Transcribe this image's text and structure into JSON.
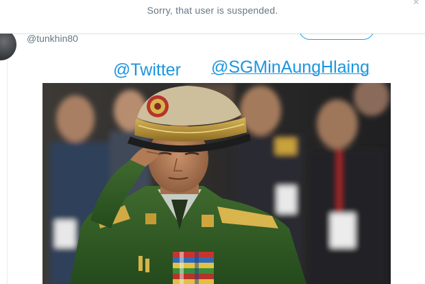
{
  "banner": {
    "message": "Sorry, that user is suspended."
  },
  "tweet": {
    "handle": "@tunkhin80",
    "mentions": [
      "@Twitter",
      "@SGMinAungHlaing"
    ]
  },
  "icons": {
    "avatar": "user-avatar",
    "close": "close-icon"
  },
  "colors": {
    "link": "#1b95e0",
    "muted_text": "#657786",
    "button_border": "#1da1f2"
  }
}
